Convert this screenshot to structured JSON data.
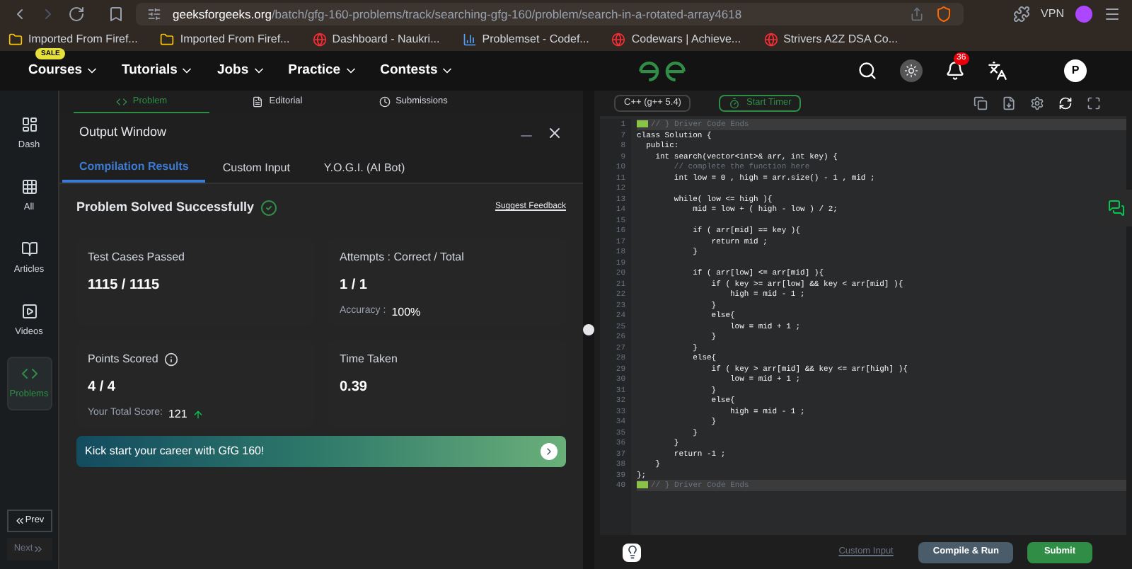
{
  "browser": {
    "url_host": "geeksforgeeks.org",
    "url_path": "/batch/gfg-160-problems/track/searching-gfg-160/problem/search-in-a-rotated-array4618",
    "vpn": "VPN",
    "bookmarks": [
      {
        "label": "Imported From Firef...",
        "kind": "folder"
      },
      {
        "label": "Imported From Firef...",
        "kind": "folder"
      },
      {
        "label": "Dashboard - Naukri...",
        "kind": "site"
      },
      {
        "label": "Problemset - Codef...",
        "kind": "chart"
      },
      {
        "label": "Codewars | Achieve...",
        "kind": "site"
      },
      {
        "label": "Strivers A2Z DSA Co...",
        "kind": "site"
      }
    ]
  },
  "nav": {
    "items": [
      {
        "label": "Courses",
        "badge": "SALE"
      },
      {
        "label": "Tutorials"
      },
      {
        "label": "Jobs"
      },
      {
        "label": "Practice"
      },
      {
        "label": "Contests"
      }
    ],
    "notifications": "36",
    "avatar": "P"
  },
  "sidebar": {
    "items": [
      {
        "label": "Dash",
        "kind": "dash",
        "selected": false
      },
      {
        "label": "All",
        "kind": "grid",
        "selected": false
      },
      {
        "label": "Articles",
        "kind": "book",
        "selected": false
      },
      {
        "label": "Videos",
        "kind": "video",
        "selected": false
      },
      {
        "label": "Problems",
        "kind": "code",
        "selected": true
      }
    ],
    "prev": "Prev",
    "next": "Next"
  },
  "problem_tabs": [
    {
      "label": "Problem",
      "kind": "code",
      "selected": true
    },
    {
      "label": "Editorial",
      "kind": "doc",
      "selected": false
    },
    {
      "label": "Submissions",
      "kind": "clock",
      "selected": false
    }
  ],
  "output_window": {
    "title": "Output Window",
    "tabs": [
      {
        "label": "Compilation Results",
        "selected": true
      },
      {
        "label": "Custom Input",
        "selected": false
      },
      {
        "label": "Y.O.G.I. (AI Bot)",
        "selected": false
      }
    ],
    "status": "Problem Solved Successfully",
    "feedback": "Suggest Feedback",
    "cards": [
      {
        "label": "Test Cases Passed",
        "value": "1115 / 1115"
      },
      {
        "label": "Attempts : Correct / Total",
        "value": "1 / 1",
        "note_label": "Accuracy :",
        "note_value": "100%"
      },
      {
        "label": "Points Scored",
        "value": "4 / 4",
        "info": true,
        "note_label": "Your Total Score:",
        "note_value": "121",
        "trend_up": true
      },
      {
        "label": "Time Taken",
        "value": "0.39"
      }
    ],
    "banner": "Kick start your career with GfG 160!"
  },
  "editor": {
    "language": "C++ (g++ 5.4)",
    "timer": "Start Timer",
    "lines": [
      {
        "number": "1",
        "kind": "marker",
        "text": "// } Driver Code Ends"
      },
      {
        "number": "7",
        "kind": "code",
        "text": "class Solution {"
      },
      {
        "number": "8",
        "kind": "code",
        "text": "  public:"
      },
      {
        "number": "9",
        "kind": "code",
        "text": "    int search(vector<int>& arr, int key) {"
      },
      {
        "number": "10",
        "kind": "comment",
        "text": "        // complete the function here"
      },
      {
        "number": "11",
        "kind": "code",
        "text": "        int low = 0 , high = arr.size() - 1 , mid ;"
      },
      {
        "number": "12",
        "kind": "code"
      },
      {
        "number": "13",
        "kind": "code",
        "text": "        while( low <= high ){"
      },
      {
        "number": "14",
        "kind": "code",
        "text": "            mid = low + ( high - low ) / 2;"
      },
      {
        "number": "15",
        "kind": "code"
      },
      {
        "number": "16",
        "kind": "code",
        "text": "            if ( arr[mid] == key ){"
      },
      {
        "number": "17",
        "kind": "code",
        "text": "                return mid ;"
      },
      {
        "number": "18",
        "kind": "code",
        "text": "            }"
      },
      {
        "number": "19",
        "kind": "code"
      },
      {
        "number": "20",
        "kind": "code",
        "text": "            if ( arr[low] <= arr[mid] ){"
      },
      {
        "number": "21",
        "kind": "code",
        "text": "                if ( key >= arr[low] && key < arr[mid] ){"
      },
      {
        "number": "22",
        "kind": "code",
        "text": "                    high = mid - 1 ;"
      },
      {
        "number": "23",
        "kind": "code",
        "text": "                }"
      },
      {
        "number": "24",
        "kind": "code",
        "text": "                else{"
      },
      {
        "number": "25",
        "kind": "code",
        "text": "                    low = mid + 1 ;"
      },
      {
        "number": "26",
        "kind": "code",
        "text": "                }"
      },
      {
        "number": "27",
        "kind": "code",
        "text": "            }"
      },
      {
        "number": "28",
        "kind": "code",
        "text": "            else{"
      },
      {
        "number": "29",
        "kind": "code",
        "text": "                if ( key > arr[mid] && key <= arr[high] ){"
      },
      {
        "number": "30",
        "kind": "code",
        "text": "                    low = mid + 1 ;"
      },
      {
        "number": "31",
        "kind": "code",
        "text": "                }"
      },
      {
        "number": "32",
        "kind": "code",
        "text": "                else{"
      },
      {
        "number": "33",
        "kind": "code",
        "text": "                    high = mid - 1 ;"
      },
      {
        "number": "34",
        "kind": "code",
        "text": "                }"
      },
      {
        "number": "35",
        "kind": "code",
        "text": "            }"
      },
      {
        "number": "36",
        "kind": "code",
        "text": "        }"
      },
      {
        "number": "37",
        "kind": "code",
        "text": "        return -1 ;"
      },
      {
        "number": "38",
        "kind": "code",
        "text": "    }"
      },
      {
        "number": "39",
        "kind": "code",
        "text": "};"
      },
      {
        "number": "40",
        "kind": "marker",
        "text": "// } Driver Code Ends"
      }
    ],
    "custom_input": "Custom Input",
    "compile": "Compile & Run",
    "submit": "Submit"
  }
}
